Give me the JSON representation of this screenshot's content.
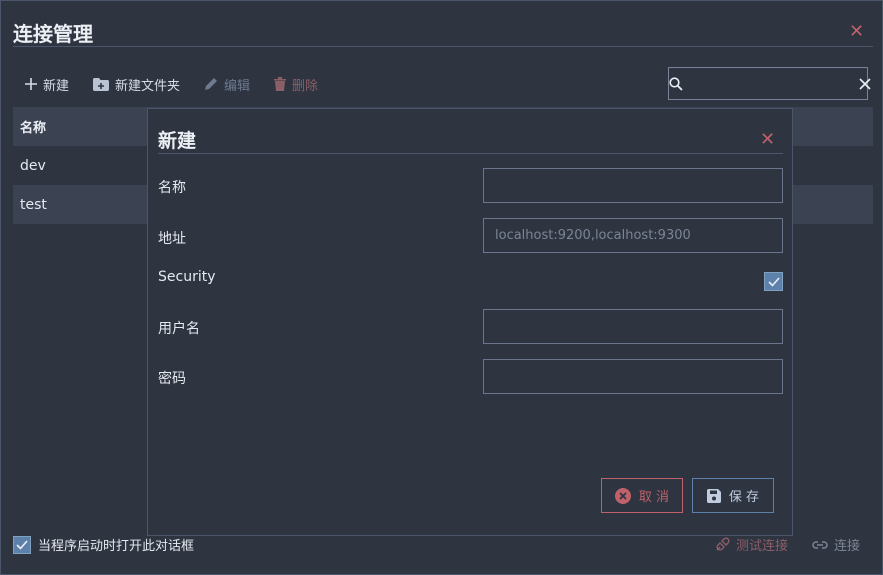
{
  "window": {
    "title": "连接管理"
  },
  "toolbar": {
    "new_label": "新建",
    "new_folder_label": "新建文件夹",
    "edit_label": "编辑",
    "delete_label": "删除"
  },
  "search": {
    "value": "",
    "placeholder": ""
  },
  "table": {
    "header": "名称",
    "rows": [
      "dev",
      "test"
    ]
  },
  "footer": {
    "startup_checkbox_label": "当程序启动时打开此对话框",
    "test_connection_label": "测试连接",
    "connect_label": "连接"
  },
  "dialog": {
    "title": "新建",
    "name_label": "名称",
    "name_value": "",
    "address_label": "地址",
    "address_placeholder": "localhost:9200,localhost:9300",
    "security_label": "Security",
    "security_checked": true,
    "username_label": "用户名",
    "username_value": "",
    "password_label": "密码",
    "password_value": "",
    "cancel_label": "取 消",
    "save_label": "保 存"
  },
  "colors": {
    "background": "#2e3440",
    "panel": "#3b4252",
    "accent": "#5e81ac",
    "danger": "#bf616a"
  }
}
